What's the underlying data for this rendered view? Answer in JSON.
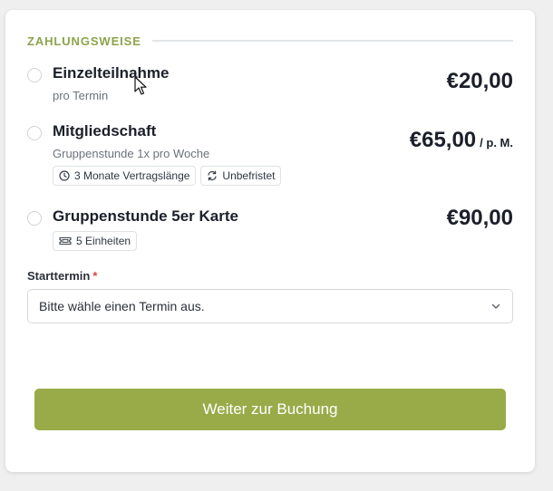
{
  "section": {
    "title": "ZAHLUNGSWEISE"
  },
  "options": [
    {
      "title": "Einzelteilnahme",
      "subtitle": "pro Termin",
      "price": "€20,00",
      "price_suffix": "",
      "tags": []
    },
    {
      "title": "Mitgliedschaft",
      "subtitle": "Gruppenstunde 1x pro Woche",
      "price": "€65,00",
      "price_suffix": "/ p. M.",
      "tags": [
        {
          "icon": "clock-icon",
          "label": "3 Monate Vertragslänge"
        },
        {
          "icon": "repeat-icon",
          "label": "Unbefristet"
        }
      ]
    },
    {
      "title": "Gruppenstunde 5er Karte",
      "subtitle": "",
      "price": "€90,00",
      "price_suffix": "",
      "tags": [
        {
          "icon": "ticket-icon",
          "label": "5 Einheiten"
        }
      ]
    }
  ],
  "start": {
    "label": "Starttermin",
    "required_marker": "*",
    "placeholder": "Bitte wähle einen Termin aus."
  },
  "submit": {
    "label": "Weiter zur Buchung"
  },
  "colors": {
    "accent": "#99ab49",
    "section_title": "#8ea24b",
    "required": "#d64545",
    "text": "#1b1f2a",
    "muted": "#6b727d"
  }
}
